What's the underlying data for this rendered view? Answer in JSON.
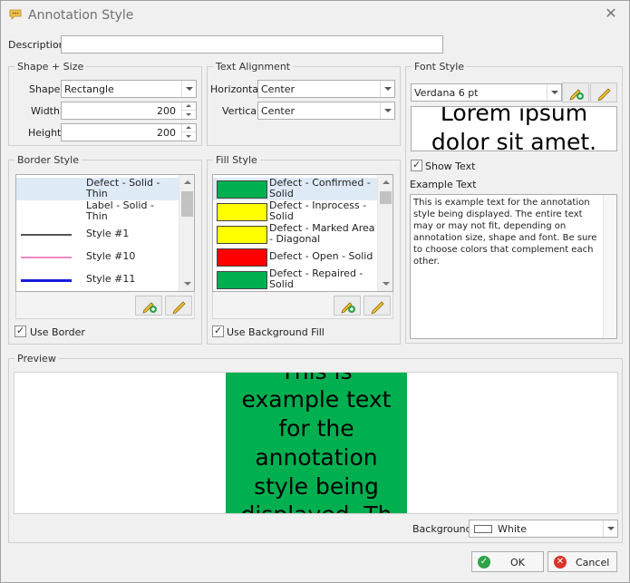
{
  "window": {
    "title": "Annotation Style"
  },
  "description": {
    "label": "Description",
    "value": ""
  },
  "shape_size": {
    "title": "Shape + Size",
    "shape_label": "Shape",
    "shape_value": "Rectangle",
    "width_label": "Width",
    "width_value": "200",
    "height_label": "Height",
    "height_value": "200"
  },
  "text_alignment": {
    "title": "Text Alignment",
    "horizontal_label": "Horizontal",
    "horizontal_value": "Center",
    "vertical_label": "Vertical",
    "vertical_value": "Center"
  },
  "font_style": {
    "title": "Font Style",
    "font_value": "Verdana 6 pt",
    "sample_line1": "Lorem ipsum",
    "sample_line2": "dolor sit amet.",
    "show_text_label": "Show Text",
    "example_text_label": "Example Text",
    "example_text_value": "This is example text for the annotation style being displayed. The entire text may or may not fit, depending on annotation size, shape and font. Be sure to choose colors that complement each other."
  },
  "border_style": {
    "title": "Border Style",
    "items": [
      {
        "label": "Defect - Solid -\nThin",
        "line_color": ""
      },
      {
        "label": "Label - Solid -\nThin",
        "line_color": ""
      },
      {
        "label": "Style #1",
        "line_color": "#555555"
      },
      {
        "label": "Style #10",
        "line_color": "#f08ac0"
      },
      {
        "label": "Style #11",
        "line_color": "#1a1ae0"
      }
    ],
    "use_border_label": "Use Border"
  },
  "fill_style": {
    "title": "Fill Style",
    "items": [
      {
        "label": "Defect - Confirmed -\nSolid",
        "color": "#00b050"
      },
      {
        "label": "Defect - Inprocess -\nSolid",
        "color": "#ffff00"
      },
      {
        "label": "Defect - Marked Area\n- Diagonal",
        "color": "#ffff00"
      },
      {
        "label": "Defect - Open - Solid",
        "color": "#ff0000"
      },
      {
        "label": "Defect - Repaired -\nSolid",
        "color": "#00b050"
      }
    ],
    "use_fill_label": "Use Background Fill"
  },
  "preview": {
    "title": "Preview",
    "fill_color": "#00b050",
    "text_lines": [
      "This is",
      "example text",
      "for the",
      "annotation",
      "style being",
      "displayed. Th"
    ],
    "background_label": "Background",
    "background_value": "White"
  },
  "buttons": {
    "ok": "OK",
    "cancel": "Cancel"
  },
  "icons": {
    "add": "add-style-icon",
    "edit": "edit-pencil-icon"
  }
}
